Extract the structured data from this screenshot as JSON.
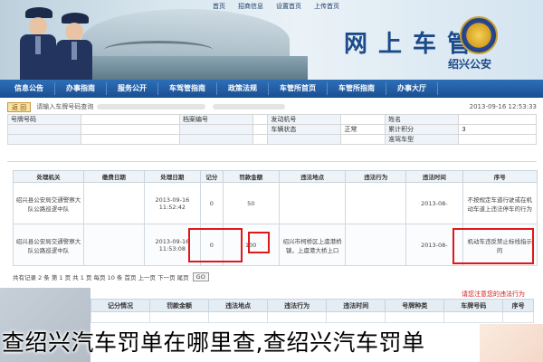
{
  "top_links": [
    "首页",
    "招商信息",
    "设置首页",
    "上传首页"
  ],
  "banner": {
    "title": "网上车管",
    "subtitle": "绍兴公安"
  },
  "nav": [
    "信息公告",
    "办事指南",
    "服务公开",
    "车驾管指南",
    "政策法规",
    "车管所首页",
    "车管所指南",
    "办事大厅"
  ],
  "info_bar": {
    "back": "返 回",
    "text": "请输入车牌号码查询",
    "date": "2013-09-16 12:53:33"
  },
  "header_rows": [
    [
      "号牌号码",
      "",
      "档案编号",
      "",
      "发动机号",
      "",
      "姓名",
      ""
    ],
    [
      "",
      "",
      "",
      "",
      "车辆状态",
      "正常",
      "累计积分",
      "3"
    ],
    [
      "",
      "",
      "",
      "",
      "",
      "",
      "准驾车型",
      ""
    ]
  ],
  "columns": [
    "序号",
    "违法时间",
    "违法地点",
    "违法行为",
    "罚款金额",
    "记分",
    "处理日期",
    "缴费日期",
    "处理机关"
  ],
  "rows": [
    {
      "act": "不按规定车道行驶或在机动车道上违法停车的行为",
      "time": "2013-08-",
      "place": "",
      "fine": "50",
      "score": "0",
      "date": "2013-09-16 11:52:42",
      "pay": "",
      "org": "绍兴县公安局交通警察大队公路巡逻中队"
    },
    {
      "act": "机动车违反禁止标线指示的",
      "time": "2013-08-",
      "place": "绍兴市柯桥区上虞港桥镇，上虞港大桥上口",
      "fine": "100",
      "score": "0",
      "date": "2013-09-16 11:53:08",
      "pay": "",
      "org": "绍兴县公安局交通警察大队公路巡逻中队"
    }
  ],
  "pager": {
    "text": "共有记录 2 条 第 1 页 共 1 页 每页 10 条 首页 上一页 下一页 尾页",
    "go": "GO"
  },
  "lower": {
    "warning": "请您注意您的违法行为",
    "columns": [
      "序号",
      "车牌号码",
      "号牌种类",
      "违法时间",
      "违法行为",
      "违法地点",
      "罚款金额",
      "记分情况"
    ]
  },
  "caption": "查绍兴汽车罚单在哪里查,查绍兴汽车罚单"
}
